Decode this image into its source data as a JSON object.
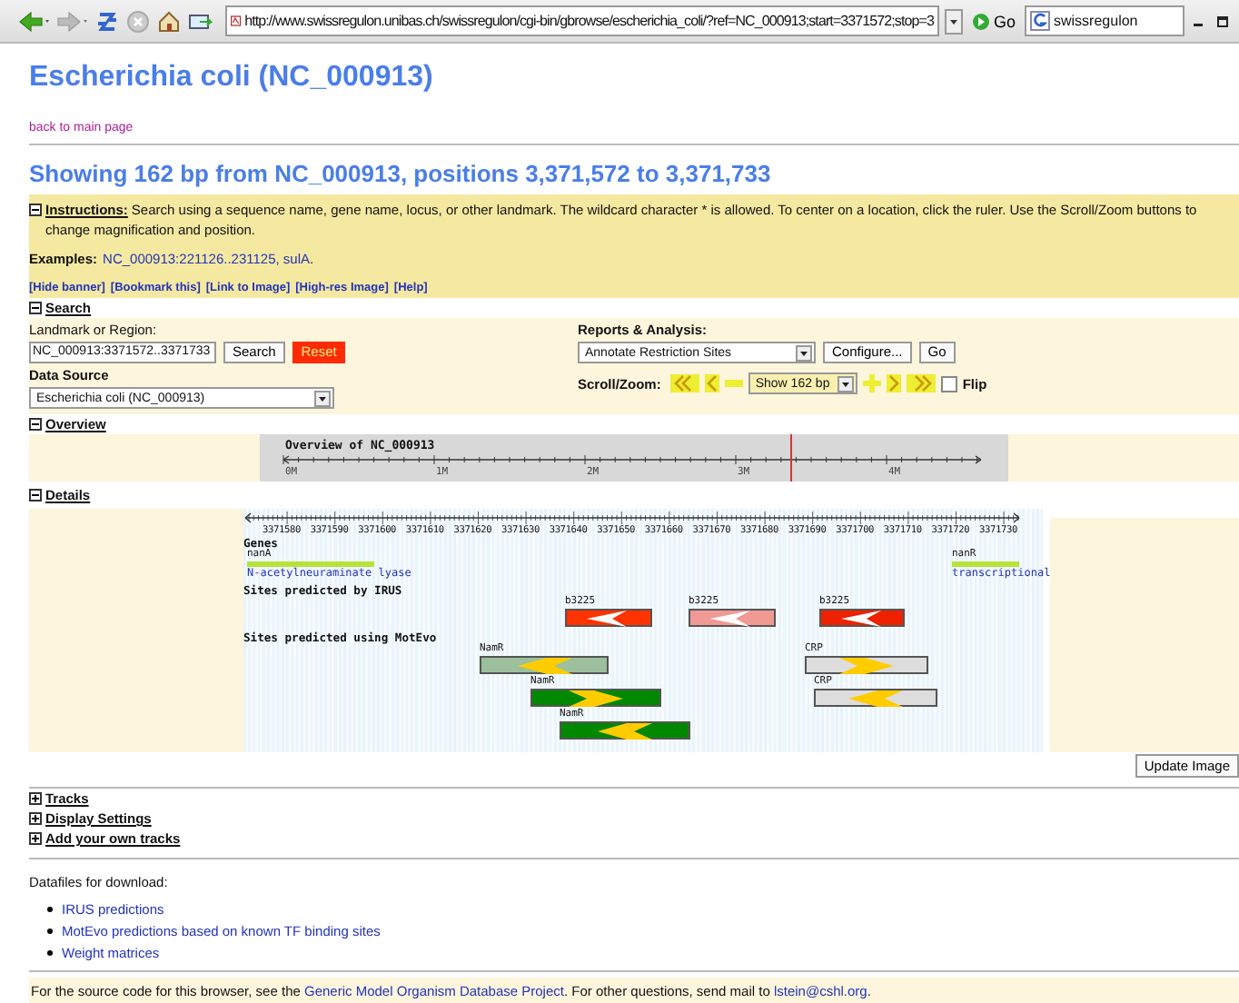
{
  "browser": {
    "url": "http://www.swissregulon.unibas.ch/swissregulon/cgi-bin/gbrowse/escherichia_coli/?ref=NC_000913;start=3371572;stop=3",
    "go_label": "Go",
    "search_value": "swissregulon"
  },
  "title": "Escherichia coli (NC_000913)",
  "back_link": "back to main page",
  "heading": "Showing 162 bp from NC_000913, positions 3,371,572 to 3,371,733",
  "instructions": {
    "expanded": true,
    "label": "Instructions:",
    "text": "Search using a sequence name, gene name, locus, or other landmark. The wildcard character * is allowed. To center on a location, click the ruler. Use the Scroll/Zoom buttons to change magnification and position.",
    "examples_label": "Examples:",
    "examples_link": "NC_000913:221126..231125, sulA",
    "examples_end": ".",
    "links": [
      "[Hide banner]",
      "[Bookmark this]",
      "[Link to Image]",
      "[High-res Image]",
      "[Help]"
    ]
  },
  "search": {
    "expanded": true,
    "label": "Search",
    "landmark_label": "Landmark or Region:",
    "landmark_value": "NC_000913:3371572..3371733",
    "buttons": [
      {
        "label": "Search",
        "kind": "plain"
      },
      {
        "label": "Reset",
        "kind": "alert"
      }
    ],
    "source_label": "Data Source",
    "source_value": "Escherichia coli (NC_000913)",
    "reports_label": "Reports & Analysis:",
    "reports_value": "Annotate Restriction Sites",
    "configure_label": "Configure...",
    "go_label": "Go",
    "scroll_label": "Scroll/Zoom:",
    "zoom_value": "Show 162 bp",
    "flip_label": "Flip",
    "flip_checked": false
  },
  "overview": {
    "expanded": true,
    "label": "Overview",
    "title": "Overview of NC_000913",
    "ticks": [
      "0M",
      "1M",
      "2M",
      "3M",
      "4M"
    ]
  },
  "details": {
    "expanded": true,
    "label": "Details",
    "ruler": [
      "3371580",
      "3371590",
      "3371600",
      "3371610",
      "3371620",
      "3371630",
      "3371640",
      "3371650",
      "3371660",
      "3371670",
      "3371680",
      "3371690",
      "3371700",
      "3371710",
      "3371720",
      "3371730"
    ],
    "tracks": [
      {
        "title": "Genes",
        "kind": "genes",
        "features": [
          {
            "label": "nanA",
            "description": "N-acetylneuraminate lyase"
          },
          {
            "label": "nanR",
            "description": "transcriptional"
          }
        ]
      },
      {
        "title": "Sites predicted by IRUS",
        "kind": "notched",
        "features": [
          {
            "label": "b3225",
            "color": "#ff3300",
            "points_left": true
          },
          {
            "label": "b3225",
            "color": "#f09a94",
            "points_left": true
          },
          {
            "label": "b3225",
            "color": "#ee2200",
            "points_left": true
          }
        ]
      },
      {
        "title": "Sites predicted using MotEvo",
        "kind": "arrowed",
        "features": [
          {
            "label": "NamR",
            "color": "#9cc09c",
            "points_left": true
          },
          {
            "label": "CRP",
            "color": "#dddddd",
            "points_left": false
          },
          {
            "label": "NamR",
            "color": "#008800",
            "points_left": false
          },
          {
            "label": "CRP",
            "color": "#dddddd",
            "points_left": true
          },
          {
            "label": "NamR",
            "color": "#008800",
            "points_left": true
          }
        ]
      }
    ],
    "update_label": "Update Image"
  },
  "collapsed_sections": [
    {
      "label": "Tracks",
      "expanded": false
    },
    {
      "label": "Display Settings",
      "expanded": false
    },
    {
      "label": "Add your own tracks",
      "expanded": false
    }
  ],
  "downloads": {
    "intro": "Datafiles for download:",
    "links": [
      "IRUS predictions",
      "MotEvo predictions based on known TF binding sites",
      "Weight matrices"
    ]
  },
  "footer": {
    "before": "For the source code for this browser, see the ",
    "link": "Generic Model Organism Database Project",
    "middle": ". For other questions, send mail to ",
    "email": "lstein@cshl.org",
    "after": "."
  }
}
